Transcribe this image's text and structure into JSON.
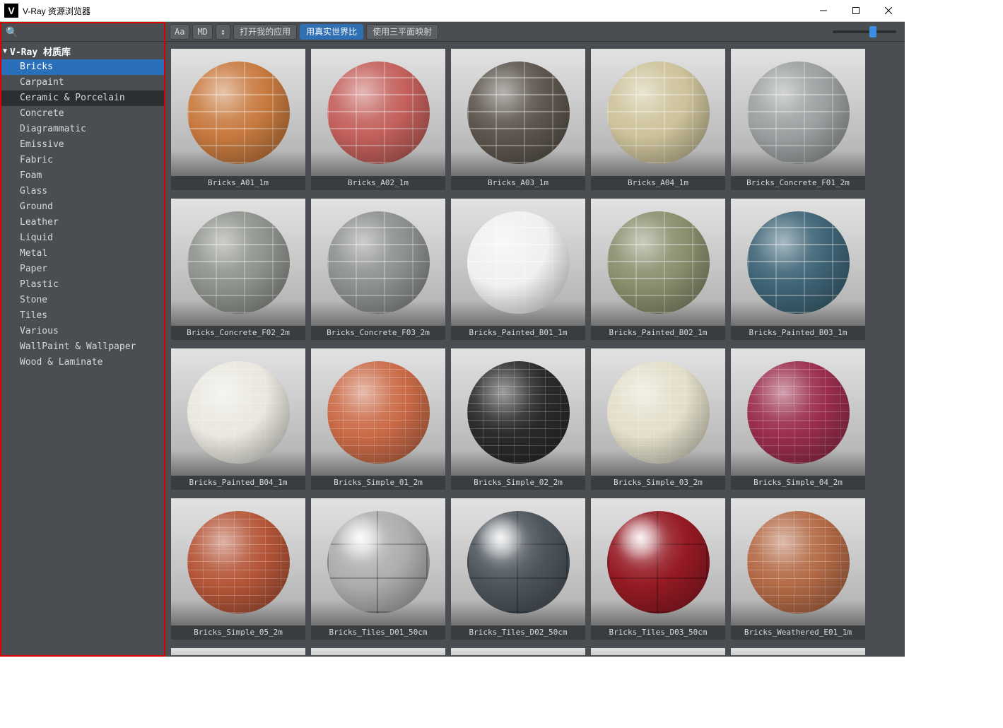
{
  "window": {
    "title": "V-Ray 资源浏览器"
  },
  "search": {
    "placeholder": ""
  },
  "tree_root": "V-Ray 材质库",
  "categories": [
    {
      "label": "Bricks",
      "state": "selected"
    },
    {
      "label": "Carpaint",
      "state": ""
    },
    {
      "label": "Ceramic & Porcelain",
      "state": "hover"
    },
    {
      "label": "Concrete",
      "state": ""
    },
    {
      "label": "Diagrammatic",
      "state": ""
    },
    {
      "label": "Emissive",
      "state": ""
    },
    {
      "label": "Fabric",
      "state": ""
    },
    {
      "label": "Foam",
      "state": ""
    },
    {
      "label": "Glass",
      "state": ""
    },
    {
      "label": "Ground",
      "state": ""
    },
    {
      "label": "Leather",
      "state": ""
    },
    {
      "label": "Liquid",
      "state": ""
    },
    {
      "label": "Metal",
      "state": ""
    },
    {
      "label": "Paper",
      "state": ""
    },
    {
      "label": "Plastic",
      "state": ""
    },
    {
      "label": "Stone",
      "state": ""
    },
    {
      "label": "Tiles",
      "state": ""
    },
    {
      "label": "Various",
      "state": ""
    },
    {
      "label": "WallPaint & Wallpaper",
      "state": ""
    },
    {
      "label": "Wood & Laminate",
      "state": ""
    }
  ],
  "toolbar": {
    "aa": "Aa",
    "md": "MD",
    "sort": "↕",
    "open": "打开我的应用",
    "realworld": "用真实世界比",
    "triplanar": "使用三平面映射"
  },
  "materials": [
    {
      "name": "Bricks_A01_1m",
      "color": "#c87a3f",
      "pattern": "brick-lines"
    },
    {
      "name": "Bricks_A02_1m",
      "color": "#c3605c",
      "pattern": "brick-lines"
    },
    {
      "name": "Bricks_A03_1m",
      "color": "#5d564e",
      "pattern": "brick-lines"
    },
    {
      "name": "Bricks_A04_1m",
      "color": "#cdc29a",
      "pattern": "brick-lines"
    },
    {
      "name": "Bricks_Concrete_F01_2m",
      "color": "#9ca0a1",
      "pattern": "brick-lines"
    },
    {
      "name": "Bricks_Concrete_F02_2m",
      "color": "#8f938d",
      "pattern": "brick-lines"
    },
    {
      "name": "Bricks_Concrete_F03_2m",
      "color": "#8d918d",
      "pattern": "brick-lines"
    },
    {
      "name": "Bricks_Painted_B01_1m",
      "color": "#f0f0ee",
      "pattern": "brick-lines"
    },
    {
      "name": "Bricks_Painted_B02_1m",
      "color": "#8a8f6e",
      "pattern": "brick-lines"
    },
    {
      "name": "Bricks_Painted_B03_1m",
      "color": "#3f6577",
      "pattern": "brick-lines"
    },
    {
      "name": "Bricks_Painted_B04_1m",
      "color": "#e9e7df",
      "pattern": "fine-lines"
    },
    {
      "name": "Bricks_Simple_01_2m",
      "color": "#ca6a47",
      "pattern": "fine-lines"
    },
    {
      "name": "Bricks_Simple_02_2m",
      "color": "#2b2b2b",
      "pattern": "fine-lines"
    },
    {
      "name": "Bricks_Simple_03_2m",
      "color": "#e2dec9",
      "pattern": "fine-lines"
    },
    {
      "name": "Bricks_Simple_04_2m",
      "color": "#9a2d4d",
      "pattern": "fine-lines"
    },
    {
      "name": "Bricks_Simple_05_2m",
      "color": "#b45538",
      "pattern": "fine-lines"
    },
    {
      "name": "Bricks_Tiles_D01_50cm",
      "color": "#adadad",
      "pattern": "tiles-lines",
      "gloss": true
    },
    {
      "name": "Bricks_Tiles_D02_50cm",
      "color": "#4d555c",
      "pattern": "tiles-lines",
      "gloss": true
    },
    {
      "name": "Bricks_Tiles_D03_50cm",
      "color": "#951a24",
      "pattern": "tiles-lines",
      "gloss": true
    },
    {
      "name": "Bricks_Weathered_E01_1m",
      "color": "#b36a46",
      "pattern": "fine-lines"
    }
  ],
  "partial_row": [
    {
      "color": "#b85c3e"
    },
    {
      "color": "#6e4f46"
    },
    {
      "color": "#7a7a7a"
    },
    {
      "color": "#746b56"
    },
    {
      "color": "#9c9c9c"
    }
  ]
}
